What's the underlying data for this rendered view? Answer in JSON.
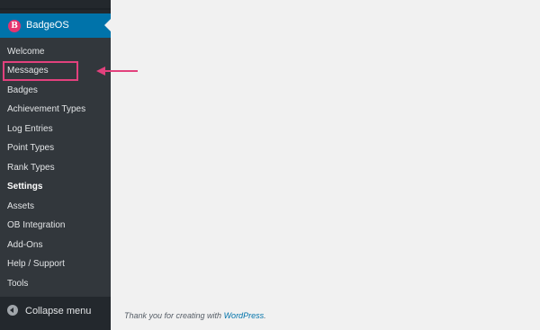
{
  "brand": {
    "logo_letter": "B",
    "label": "BadgeOS"
  },
  "submenu": {
    "items": [
      {
        "label": "Welcome"
      },
      {
        "label": "Messages"
      },
      {
        "label": "Badges"
      },
      {
        "label": "Achievement Types"
      },
      {
        "label": "Log Entries"
      },
      {
        "label": "Point Types"
      },
      {
        "label": "Rank Types"
      },
      {
        "label": "Settings"
      },
      {
        "label": "Assets"
      },
      {
        "label": "OB Integration"
      },
      {
        "label": "Add-Ons"
      },
      {
        "label": "Help / Support"
      },
      {
        "label": "Tools"
      }
    ]
  },
  "collapse": {
    "label": "Collapse menu"
  },
  "footer": {
    "prefix": "Thank you for creating with ",
    "link": "WordPress",
    "suffix": "."
  },
  "colors": {
    "sidebar_bg": "#23282d",
    "submenu_bg": "#32373c",
    "active_blue": "#0073aa",
    "accent_pink": "#e2417d",
    "content_bg": "#f1f1f1"
  },
  "icons": {
    "brand": "badgeos-logo-icon",
    "collapse": "collapse-arrow-icon",
    "annotation": "pointer-arrow-icon"
  }
}
